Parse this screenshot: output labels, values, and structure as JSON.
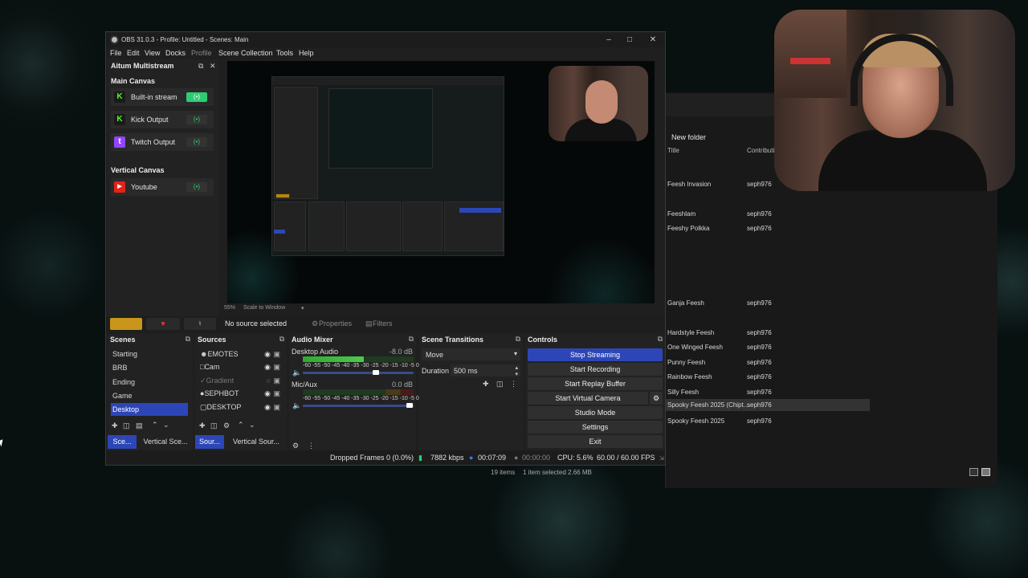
{
  "explorer": {
    "new_folder": "New folder",
    "col_title": "Title",
    "col_contrib": "Contributi",
    "rows": [
      {
        "title": "Feesh Invasion",
        "contrib": "seph976"
      },
      {
        "title": "Feeshlam",
        "contrib": "seph976"
      },
      {
        "title": "Feeshy Polkka",
        "contrib": "seph976"
      },
      {
        "title": "Ganja Feesh",
        "contrib": "seph976"
      },
      {
        "title": "Hardstyle Feesh",
        "contrib": "seph976"
      },
      {
        "title": "One Winged Feesh",
        "contrib": "seph976"
      },
      {
        "title": "Punny Feesh",
        "contrib": "seph976"
      },
      {
        "title": "Rainbow Feesh",
        "contrib": "seph976"
      },
      {
        "title": "Silly Feesh",
        "contrib": "seph976"
      },
      {
        "title": "Spooky Feesh 2025 (Chipt...",
        "contrib": "seph976"
      },
      {
        "title": "Spooky Feesh 2025",
        "contrib": "seph976"
      }
    ],
    "status_items": "19 items",
    "status_selected": "1 item selected  2.66 MB"
  },
  "obs": {
    "title": "OBS 31.0.3 - Profile: Untitled - Scenes: Main",
    "menu": [
      "File",
      "Edit",
      "View",
      "Docks",
      "Profile",
      "Scene Collection",
      "Tools",
      "Help"
    ],
    "multistream": {
      "title": "Aitum Multistream",
      "main_canvas": "Main Canvas",
      "vertical_canvas": "Vertical Canvas",
      "outputs": [
        {
          "name": "Built-in stream",
          "platform": "kick-logo",
          "active": true
        },
        {
          "name": "Kick Output",
          "platform": "kick-logo",
          "active": false
        },
        {
          "name": "Twitch Output",
          "platform": "twitch-logo",
          "active": false
        },
        {
          "name": "Youtube",
          "platform": "youtube-logo",
          "active": false
        }
      ],
      "accent": "#2ecc71"
    },
    "zoom": {
      "percent": "55%",
      "mode": "Scale to Window"
    },
    "context": {
      "no_source": "No source selected",
      "properties": "Properties",
      "filters": "Filters"
    },
    "scenes": {
      "title": "Scenes",
      "items": [
        "Starting",
        "BRB",
        "Ending",
        "Game",
        "Desktop"
      ],
      "selected": "Desktop",
      "tabs": [
        "Sce...",
        "Vertical Sce..."
      ]
    },
    "sources": {
      "title": "Sources",
      "items": [
        "EMOTES",
        "Cam",
        "Gradient",
        "SEPHBOT",
        "DESKTOP"
      ],
      "tabs": [
        "Sour...",
        "Vertical Sour..."
      ]
    },
    "mixer": {
      "title": "Audio Mixer",
      "channels": [
        {
          "name": "Desktop Audio",
          "db": "-8.0 dB",
          "level": 0.55
        },
        {
          "name": "Mic/Aux",
          "db": "0.0 dB",
          "level": 0.0
        }
      ],
      "scale": "-60 -55 -50 -45 -40 -35 -30 -25 -20 -15 -10 -5  0"
    },
    "transitions": {
      "title": "Scene Transitions",
      "type": "Move",
      "duration_label": "Duration",
      "duration": "500 ms"
    },
    "controls": {
      "title": "Controls",
      "buttons": [
        "Stop Streaming",
        "Start Recording",
        "Start Replay Buffer",
        "Start Virtual Camera",
        "Studio Mode",
        "Settings",
        "Exit"
      ]
    },
    "status": {
      "dropped": "Dropped Frames 0 (0.0%)",
      "bitrate": "7882 kbps",
      "stream_time": "00:07:09",
      "rec_time": "00:00:00",
      "cpu": "CPU: 5.6%",
      "fps": "60.00 / 60.00 FPS"
    }
  }
}
